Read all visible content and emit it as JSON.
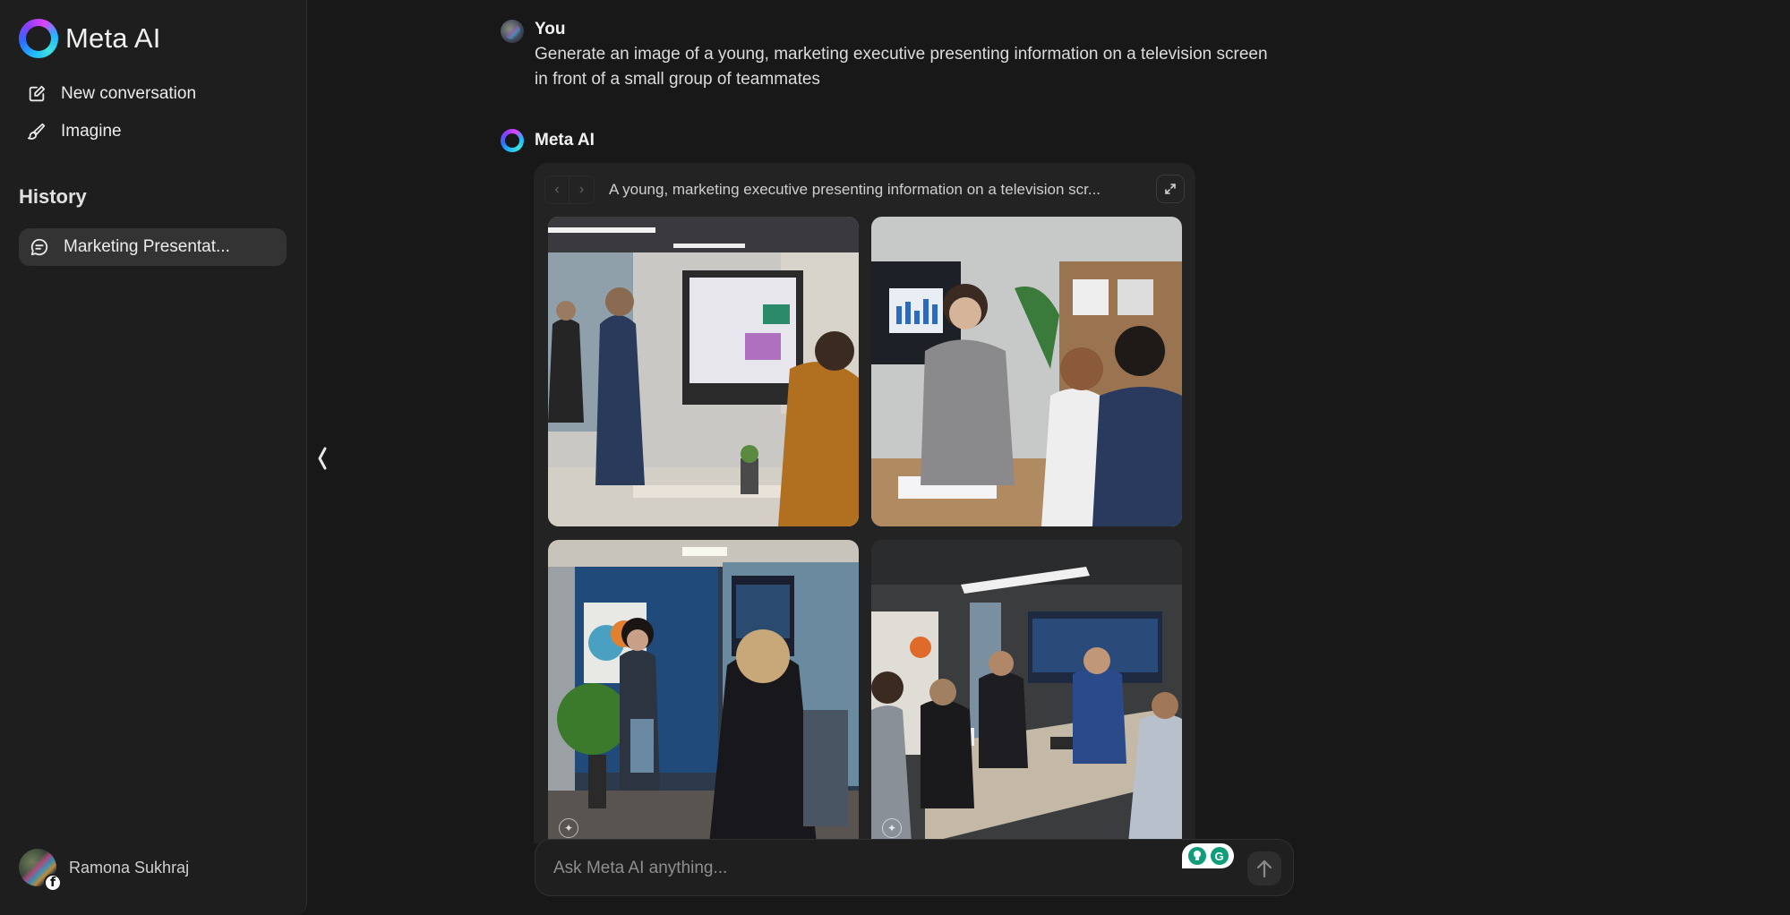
{
  "app": {
    "name": "Meta AI",
    "accent_gradient": [
      "#1fb6ff",
      "#2f6bff",
      "#8a3ffc",
      "#e040fb",
      "#3ee0e0"
    ]
  },
  "sidebar": {
    "nav": [
      {
        "label": "New conversation",
        "icon": "edit-icon"
      },
      {
        "label": "Imagine",
        "icon": "brush-icon"
      }
    ],
    "history_title": "History",
    "history": [
      {
        "label": "Marketing Presentat...",
        "icon": "chat-bubble-icon",
        "active": true
      }
    ],
    "user": {
      "name": "Ramona Sukhraj",
      "badge": "facebook-icon"
    }
  },
  "conversation": {
    "user_message": {
      "sender": "You",
      "text": "Generate an image of a young, marketing executive presenting information on a television screen in front of a small group of teammates"
    },
    "ai_message": {
      "sender": "Meta AI",
      "gallery": {
        "caption": "A young, marketing executive presenting information on a television scr...",
        "prev_icon": "chevron-left-icon",
        "next_icon": "chevron-right-icon",
        "expand_icon": "expand-icon",
        "images": [
          {
            "description": "Young man in navy suit presenting charts on a large monitor to colleagues in bright office"
          },
          {
            "description": "Young woman in grey blazer with remote presenting bar chart on TV to seated teammates"
          },
          {
            "description": "Woman in dark suit presenting dashboard on wall-mounted screen in blue-walled office with plants"
          },
          {
            "description": "Man in blue suit presenting on wall TV to team seated around conference table"
          }
        ],
        "watermark_icon": "imagine-watermark-icon"
      }
    }
  },
  "composer": {
    "placeholder": "Ask Meta AI anything...",
    "value": "",
    "send_icon": "arrow-up-icon",
    "extensions": [
      "lightbulb-icon",
      "grammarly-icon"
    ]
  }
}
